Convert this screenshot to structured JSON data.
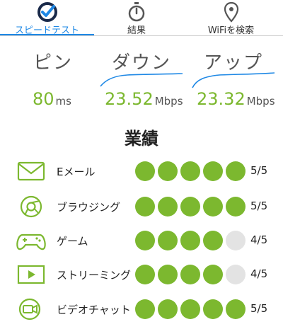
{
  "tabs": [
    {
      "label": "スピードテスト",
      "icon": "speedometer-check-icon",
      "active": true
    },
    {
      "label": "結果",
      "icon": "stopwatch-icon",
      "active": false
    },
    {
      "label": "WiFiを検索",
      "icon": "location-pin-icon",
      "active": false
    }
  ],
  "metrics": {
    "ping": {
      "label": "ピン",
      "value": "80",
      "unit": "ms"
    },
    "download": {
      "label": "ダウン",
      "value": "23.52",
      "unit": "Mbps"
    },
    "upload": {
      "label": "アップ",
      "value": "23.32",
      "unit": "Mbps"
    }
  },
  "performance": {
    "title": "業績",
    "max": 5,
    "rows": [
      {
        "label": "Eメール",
        "icon": "mail-icon",
        "rating": 5,
        "score": "5/5"
      },
      {
        "label": "ブラウジング",
        "icon": "browser-icon",
        "rating": 5,
        "score": "5/5"
      },
      {
        "label": "ゲーム",
        "icon": "gamepad-icon",
        "rating": 4,
        "score": "4/5"
      },
      {
        "label": "ストリーミング",
        "icon": "video-play-icon",
        "rating": 4,
        "score": "4/5"
      },
      {
        "label": "ビデオチャット",
        "icon": "video-chat-icon",
        "rating": 5,
        "score": "5/5"
      }
    ]
  },
  "colors": {
    "accent": "#1e88e5",
    "good": "#7cb82f",
    "off": "#e3e3e3"
  }
}
